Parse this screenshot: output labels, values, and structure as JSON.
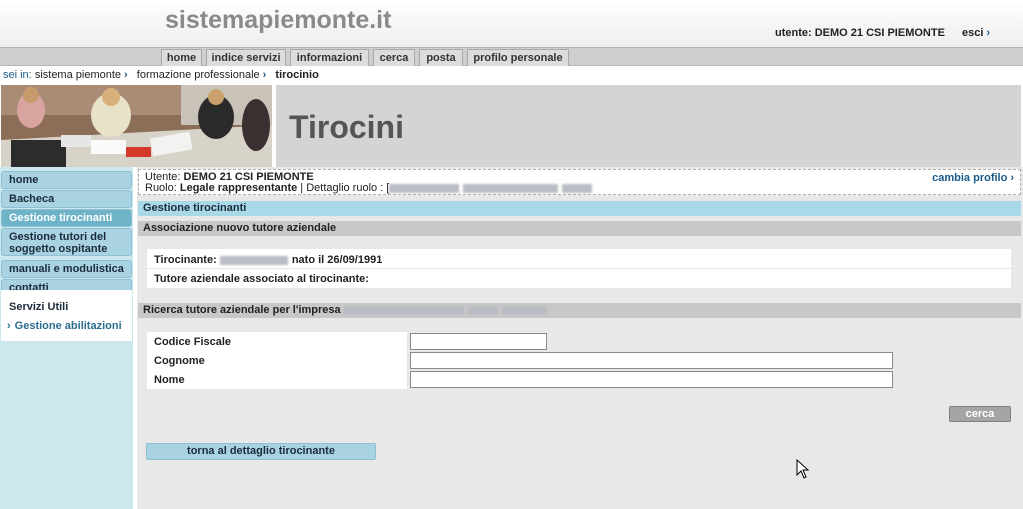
{
  "header": {
    "logo": "sistemapiemonte.it",
    "user_label": "utente: DEMO 21 CSI PIEMONTE",
    "logout": "esci"
  },
  "topnav": {
    "tabs": [
      "home",
      "indice servizi",
      "informazioni",
      "cerca",
      "posta",
      "profilo personale"
    ]
  },
  "breadcrumb": {
    "label": "sei in:",
    "items": [
      "sistema piemonte",
      "formazione professionale"
    ],
    "current": "tirocinio"
  },
  "banner": {
    "title": "Tirocini"
  },
  "sidebar": {
    "items": [
      "home",
      "Bacheca",
      "Gestione tirocinanti",
      "Gestione tutori del soggetto ospitante",
      "manuali e modulistica",
      "contatti"
    ],
    "active_index": 2,
    "servizi_title": "Servizi Utili",
    "servizi_link": "Gestione abilitazioni"
  },
  "userinfo": {
    "utente_label": "Utente:",
    "utente_value": "DEMO 21 CSI PIEMONTE",
    "ruolo_label": "Ruolo:",
    "ruolo_value": "Legale rappresentante",
    "dettaglio_label": "| Dettaglio ruolo : [",
    "cambia": "cambia profilo"
  },
  "sections": {
    "gestione": "Gestione tirocinanti",
    "associazione": "Associazione nuovo tutore aziendale",
    "ricerca": "Ricerca tutore aziendale per l'impresa"
  },
  "tirocinante": {
    "label": "Tirocinante:",
    "nato": "nato il 26/09/1991",
    "tutore_label": "Tutore aziendale associato al tirocinante:"
  },
  "form": {
    "fields": [
      {
        "label": "Codice Fiscale",
        "value": ""
      },
      {
        "label": "Cognome",
        "value": ""
      },
      {
        "label": "Nome",
        "value": ""
      }
    ]
  },
  "buttons": {
    "cerca": "cerca",
    "torna": "torna al dettaglio tirocinante"
  },
  "colors": {
    "accent_blue": "#a9d8e8",
    "link_blue": "#1a5a8a",
    "active_item": "#6fb3c9"
  }
}
